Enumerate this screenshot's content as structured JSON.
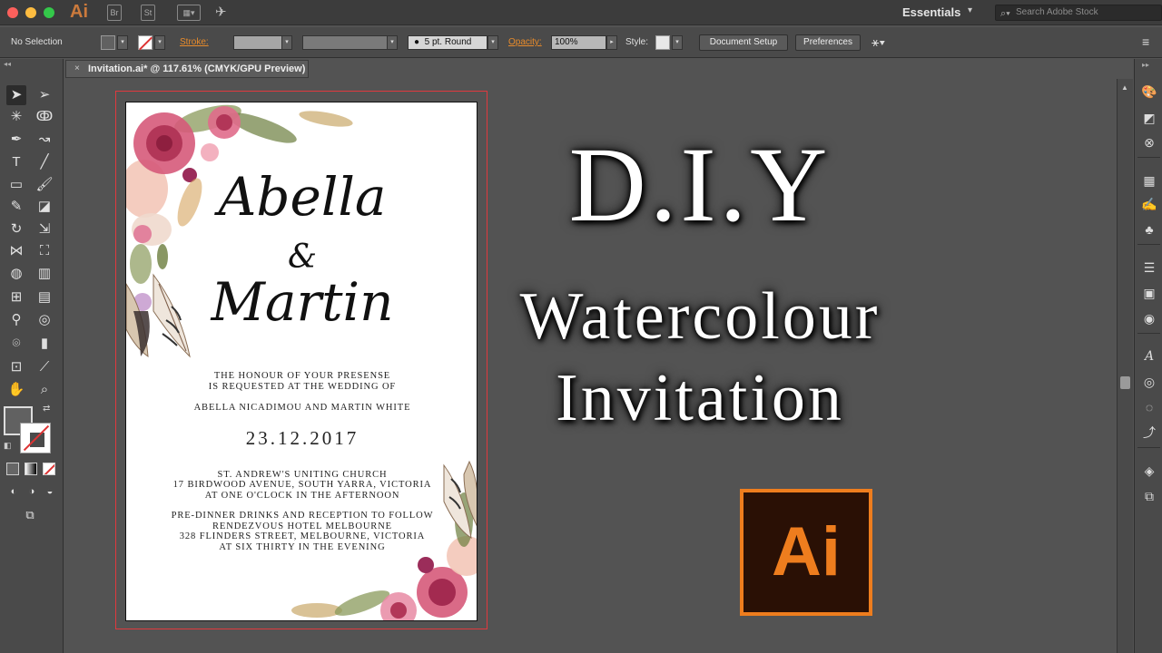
{
  "app": {
    "name": "Ai",
    "workspace": "Essentials",
    "stock_search_placeholder": "Search Adobe Stock",
    "appbar_buttons": [
      "Br",
      "St"
    ]
  },
  "control_bar": {
    "selection_label": "No Selection",
    "stroke_label": "Stroke:",
    "brush_label": "5 pt. Round",
    "opacity_label": "Opacity:",
    "opacity_value": "100%",
    "style_label": "Style:",
    "document_setup": "Document Setup",
    "preferences": "Preferences"
  },
  "document": {
    "tab_title": "Invitation.ai* @ 117.61% (CMYK/GPU Preview)",
    "close_glyph": "×"
  },
  "invitation": {
    "name1": "Abella",
    "ampersand": "&",
    "name2": "Martin",
    "honour_line1": "THE HONOUR OF YOUR PRESENSE",
    "honour_line2": "IS REQUESTED AT THE WEDDING OF",
    "couple": "ABELLA NICADIMOU AND MARTIN WHITE",
    "date": "23.12.2017",
    "venue_line1": "ST. ANDREW'S UNITING CHURCH",
    "venue_line2": "17 BIRDWOOD AVENUE, SOUTH YARRA, VICTORIA",
    "venue_line3": "AT ONE O'CLOCK IN THE AFTERNOON",
    "reception_line1": "PRE-DINNER DRINKS AND RECEPTION TO FOLLOW",
    "reception_line2": "RENDEZVOUS HOTEL MELBOURNE",
    "reception_line3": "328 FLINDERS STREET, MELBOURNE, VICTORIA",
    "reception_line4": "AT SIX THIRTY IN THE EVENING"
  },
  "headline": {
    "line1": "D.I.Y",
    "line2": "Watercolour",
    "line3": "Invitation",
    "logo_text": "Ai"
  },
  "colors": {
    "accent_orange": "#ee7d1e",
    "bleed_red": "#e0393e"
  }
}
